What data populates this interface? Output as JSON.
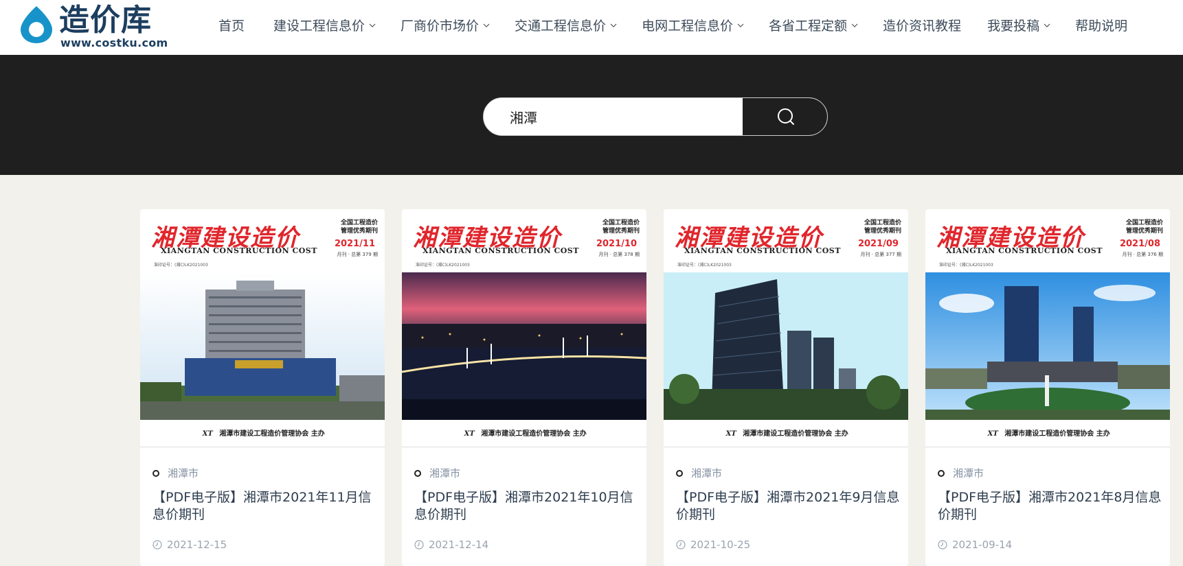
{
  "logo": {
    "cn": "造价库",
    "url": "www.costku.com",
    "brand_color": "#1c3e5f",
    "accent_color": "#1793c9"
  },
  "nav": [
    {
      "label": "首页",
      "dropdown": false
    },
    {
      "label": "建设工程信息价",
      "dropdown": true
    },
    {
      "label": "厂商价市场价",
      "dropdown": true
    },
    {
      "label": "交通工程信息价",
      "dropdown": true
    },
    {
      "label": "电网工程信息价",
      "dropdown": true
    },
    {
      "label": "各省工程定额",
      "dropdown": true
    },
    {
      "label": "造价资讯教程",
      "dropdown": false
    },
    {
      "label": "我要投稿",
      "dropdown": true
    },
    {
      "label": "帮助说明",
      "dropdown": false
    }
  ],
  "search": {
    "value": "湘潭",
    "icon": "search-icon"
  },
  "cover": {
    "title": "湘潭建设造价",
    "en": "XIANGTAN CONSTRUCTION COST",
    "tag_line1": "全国工程造价",
    "tag_line2": "管理优秀期刊",
    "footer": "湘潭市建设工程造价管理协会 主办",
    "footer_mark": "XT",
    "small_text": "准印证号：(湘C)LK2021003",
    "title_color": "#e0262c"
  },
  "cards": [
    {
      "issue": "2021/11",
      "sub": "月刊 · 总第 379 期",
      "category": "湘潭市",
      "title": "【PDF电子版】湘潭市2021年11月信息价期刊",
      "date": "2021-12-15"
    },
    {
      "issue": "2021/10",
      "sub": "月刊 · 总第 378 期",
      "category": "湘潭市",
      "title": "【PDF电子版】湘潭市2021年10月信息价期刊",
      "date": "2021-12-14"
    },
    {
      "issue": "2021/09",
      "sub": "月刊 · 总第 377 期",
      "category": "湘潭市",
      "title": "【PDF电子版】湘潭市2021年9月信息价期刊",
      "date": "2021-10-25"
    },
    {
      "issue": "2021/08",
      "sub": "月刊 · 总第 376 期",
      "category": "湘潭市",
      "title": "【PDF电子版】湘潭市2021年8月信息价期刊",
      "date": "2021-09-14"
    }
  ]
}
